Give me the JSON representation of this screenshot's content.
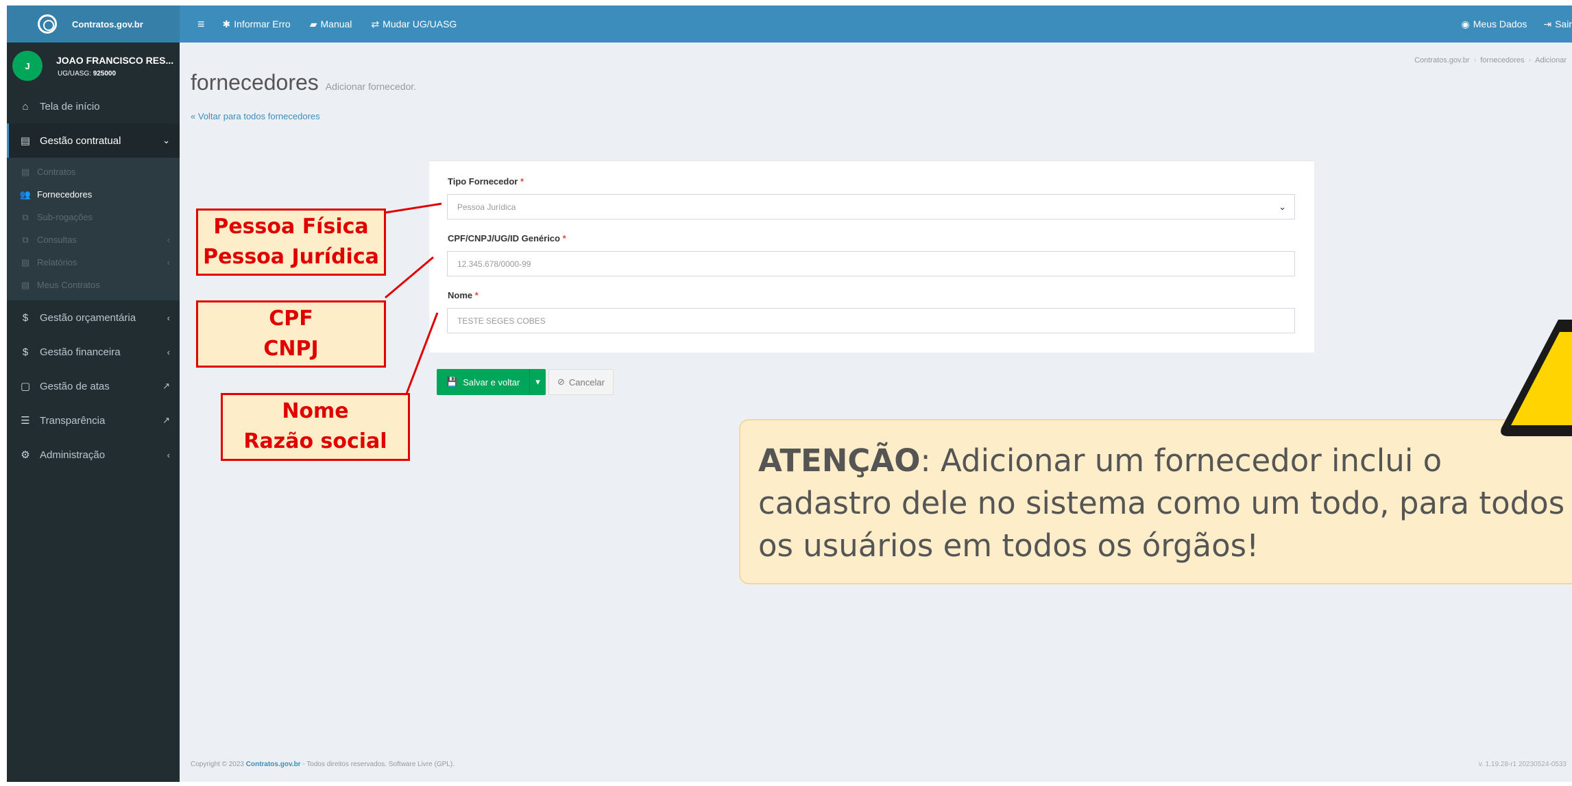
{
  "brand": "Contratos.gov.br",
  "user": {
    "initial": "J",
    "name": "JOAO FRANCISCO RES...",
    "ug_label": "UG/UASG:",
    "ug_value": "925000"
  },
  "sidebar": {
    "items": [
      {
        "label": "Tela de início",
        "icon": "home-icon"
      },
      {
        "label": "Gestão contratual",
        "icon": "document-icon"
      },
      {
        "label": "Gestão orçamentária",
        "icon": "dollar-icon"
      },
      {
        "label": "Gestão financeira",
        "icon": "dollar-icon"
      },
      {
        "label": "Gestão de atas",
        "icon": "file-icon"
      },
      {
        "label": "Transparência",
        "icon": "list-icon"
      },
      {
        "label": "Administração",
        "icon": "cogs-icon"
      }
    ],
    "submenu": [
      {
        "label": "Contratos"
      },
      {
        "label": "Fornecedores"
      },
      {
        "label": "Sub-rogações"
      },
      {
        "label": "Consultas"
      },
      {
        "label": "Relatórios"
      },
      {
        "label": "Meus Contratos"
      }
    ]
  },
  "topbar": {
    "links": [
      "Informar Erro",
      "Manual",
      "Mudar UG/UASG"
    ],
    "right": [
      "Meus Dados",
      "Sair"
    ]
  },
  "page": {
    "title": "fornecedores",
    "subtitle": "Adicionar fornecedor.",
    "back": "Voltar para todos fornecedores",
    "breadcrumb": [
      "Contratos.gov.br",
      "fornecedores",
      "Adicionar"
    ]
  },
  "form": {
    "tipo_label": "Tipo Fornecedor",
    "tipo_value": "Pessoa Jurídica",
    "cpf_label": "CPF/CNPJ/UG/ID Genérico",
    "cpf_value": "12.345.678/0000-99",
    "nome_label": "Nome",
    "nome_value": "TESTE SEGES COBES",
    "required_mark": "*",
    "save_label": "Salvar e voltar",
    "cancel_label": "Cancelar"
  },
  "footer": {
    "prefix": "Copyright © 2023",
    "brand": "Contratos.gov.br",
    "suffix": "- Todos direitos reservados. Software Livre (GPL).",
    "version": "v. 1.19.28-r1 20230524-0533"
  },
  "annotations": {
    "tipo": [
      "Pessoa Física",
      "Pessoa Jurídica"
    ],
    "cpf": [
      "CPF",
      "CNPJ"
    ],
    "nome": [
      "Nome",
      "Razão social"
    ],
    "warning_strong": "ATENÇÃO",
    "warning_text": ": Adicionar um fornecedor inclui o cadastro dele no sistema como um todo, para todos os usuários em todos os órgãos!",
    "callout_color": "#e00000",
    "callout_bg": "#fdedc8"
  }
}
